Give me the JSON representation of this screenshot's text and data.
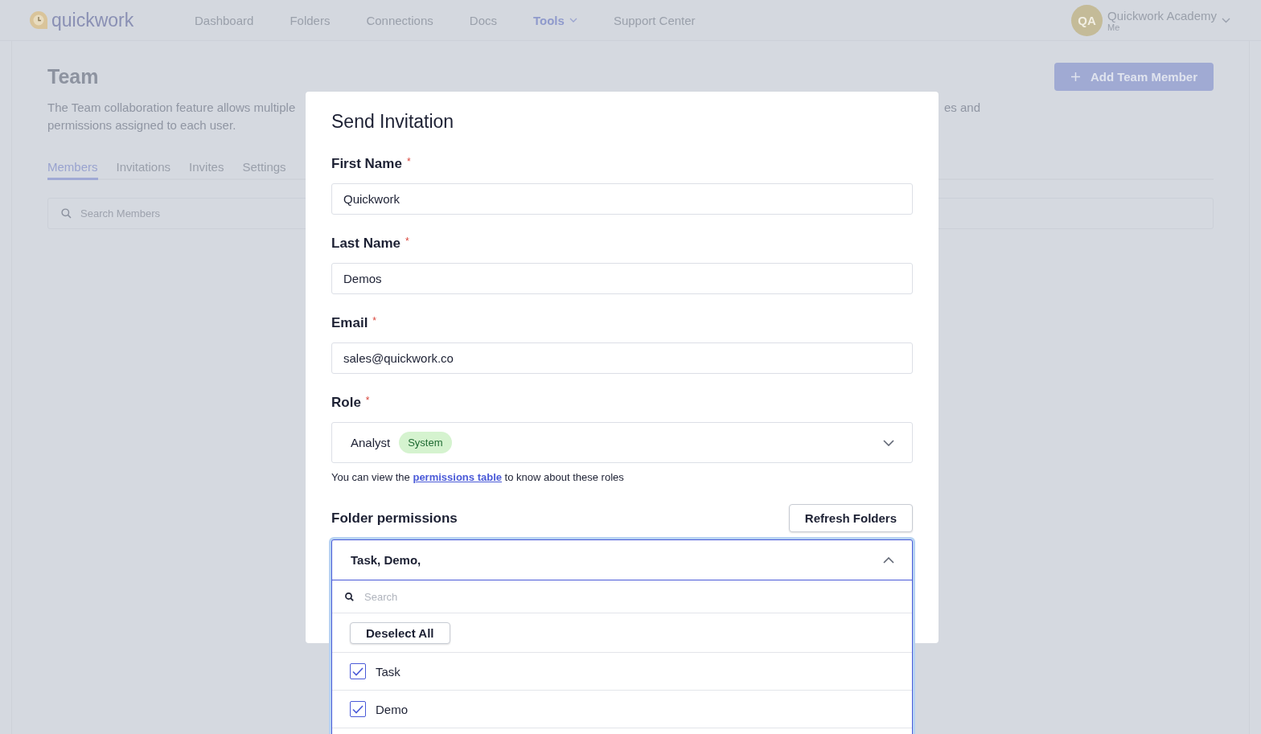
{
  "nav": {
    "brand": "quickwork",
    "items": [
      {
        "label": "Dashboard",
        "selected": false,
        "dropdown": false
      },
      {
        "label": "Folders",
        "selected": false,
        "dropdown": false
      },
      {
        "label": "Connections",
        "selected": false,
        "dropdown": false
      },
      {
        "label": "Docs",
        "selected": false,
        "dropdown": false
      },
      {
        "label": "Tools",
        "selected": true,
        "dropdown": true
      },
      {
        "label": "Support Center",
        "selected": false,
        "dropdown": false
      }
    ],
    "user": {
      "initials": "QA",
      "name": "Quickwork Academy",
      "subtitle": "Me"
    }
  },
  "page": {
    "title": "Team",
    "description_left": [
      "The Team collaboration feature allows multiple",
      "permissions assigned to each user."
    ],
    "description_right": "es and",
    "add_button": "Add Team Member",
    "tabs": [
      {
        "label": "Members",
        "selected": true
      },
      {
        "label": "Invitations",
        "selected": false
      },
      {
        "label": "Invites",
        "selected": false
      },
      {
        "label": "Settings",
        "selected": false
      }
    ],
    "search": {
      "placeholder": "Search Members"
    }
  },
  "modal": {
    "title": "Send Invitation",
    "fields": [
      {
        "label": "First Name",
        "required_mark": "*",
        "value": "Quickwork"
      },
      {
        "label": "Last Name",
        "required_mark": "*",
        "value": "Demos"
      },
      {
        "label": "Email",
        "required_mark": "*",
        "value": "sales@quickwork.co"
      }
    ],
    "role": {
      "label": "Role",
      "required_mark": "*",
      "value": "Analyst",
      "badge": "System",
      "help_before": "You can view the",
      "help_link": "permissions table",
      "help_after": "to know about these roles"
    },
    "folders": {
      "label": "Folder permissions",
      "refresh_button": "Refresh Folders",
      "value": "Task, Demo,",
      "expanded": true,
      "search_placeholder": "Search",
      "deselect_button": "Deselect All",
      "options": [
        {
          "label": "Task",
          "checked": true
        },
        {
          "label": "Demo",
          "checked": true
        }
      ]
    }
  }
}
